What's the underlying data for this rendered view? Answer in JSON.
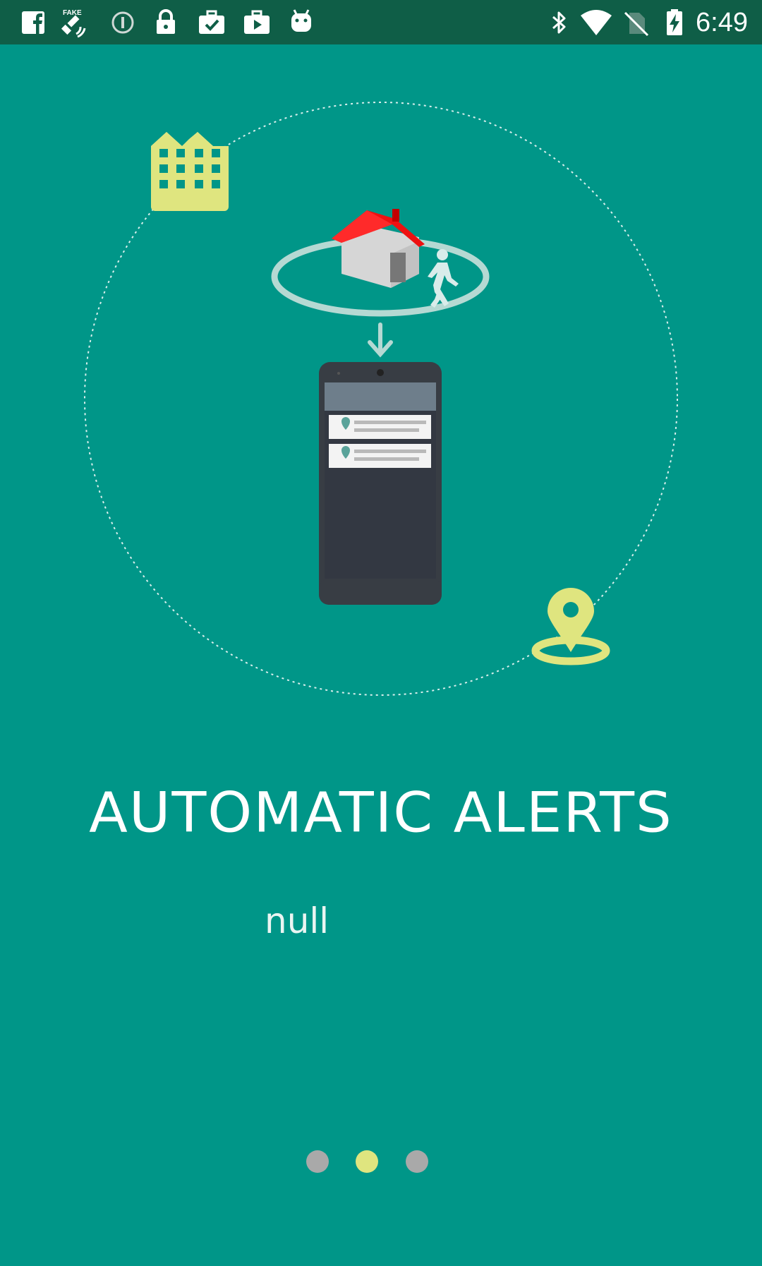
{
  "status_bar": {
    "time": "6:49",
    "left_icons": [
      "facebook-icon",
      "fake-gps-icon",
      "info-circle-icon",
      "lock-icon",
      "briefcase-check-icon",
      "play-store-icon",
      "android-icon"
    ],
    "right_icons": [
      "bluetooth-icon",
      "wifi-icon",
      "no-sim-icon",
      "battery-charging-icon"
    ],
    "fake_label": "FAKE"
  },
  "onboarding": {
    "title": "AUTOMATIC ALERTS",
    "description": "null",
    "page_count": 3,
    "current_page": 2
  },
  "colors": {
    "background": "#009688",
    "status_bar": "#0f5e47",
    "accent": "#dfe57f",
    "dot_inactive": "#a9a9a9",
    "house_roof": "#ee1111",
    "phone_body": "#383d44"
  }
}
